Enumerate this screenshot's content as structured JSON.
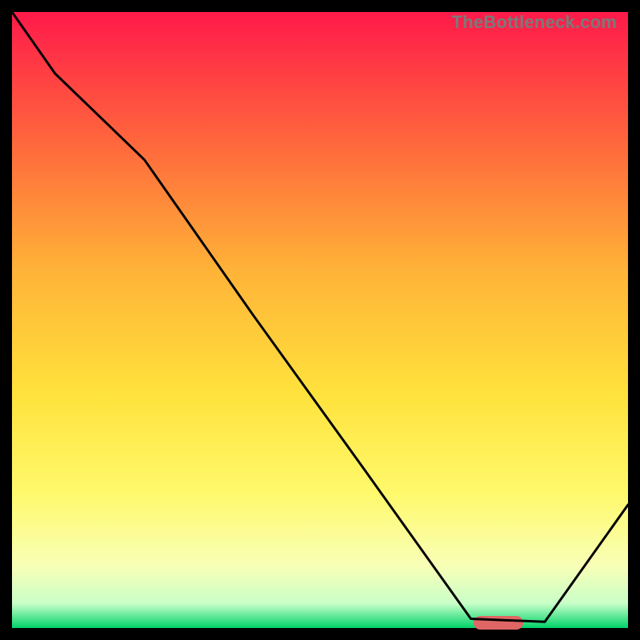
{
  "watermark": "TheBottleneck.com",
  "colors": {
    "stop0": "#ff1a4a",
    "stop1": "#ff6a3c",
    "stop2": "#ffb338",
    "stop3": "#ffe23c",
    "stop4": "#fff96b",
    "stop5": "#f8ffb7",
    "stop6": "#c9ffc8",
    "stop7": "#00d36a",
    "line": "#000000",
    "marker": "#e06666"
  },
  "marker": {
    "x_frac": 0.79,
    "y_frac": 0.9905
  },
  "chart_data": {
    "type": "line",
    "title": "",
    "xlabel": "",
    "ylabel": "",
    "xlim": [
      0,
      1
    ],
    "ylim": [
      0,
      1
    ],
    "x": [
      0.0,
      0.07,
      0.215,
      0.39,
      0.57,
      0.745,
      0.865,
      1.0
    ],
    "mismatch": [
      1.0,
      0.9,
      0.76,
      0.51,
      0.26,
      0.015,
      0.01,
      0.2
    ]
  }
}
